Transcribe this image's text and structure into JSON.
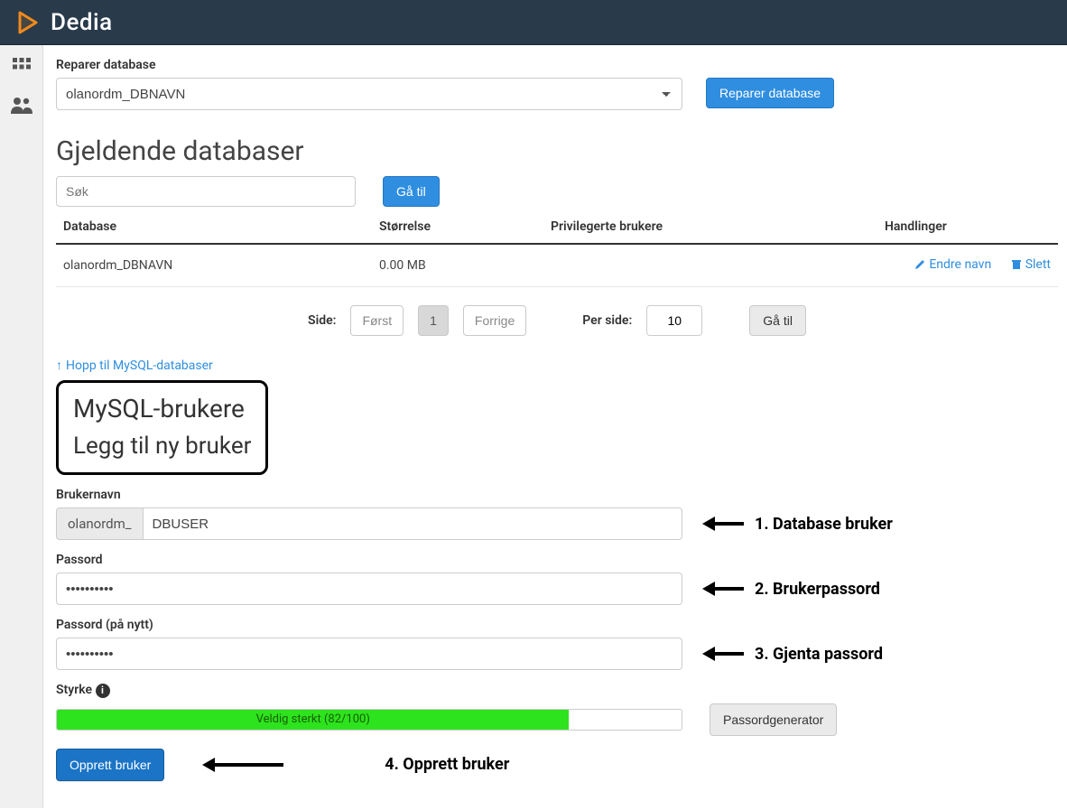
{
  "header": {
    "brand": "Dedia"
  },
  "repair": {
    "label": "Reparer database",
    "selected": "olanordm_DBNAVN",
    "button": "Reparer database"
  },
  "current_dbs": {
    "title": "Gjeldende databaser",
    "search_placeholder": "Søk",
    "goto": "Gå til",
    "columns": {
      "db": "Database",
      "size": "Størrelse",
      "users": "Privilegerte brukere",
      "actions": "Handlinger"
    },
    "rows": [
      {
        "name": "olanordm_DBNAVN",
        "size": "0.00 MB",
        "rename": "Endre navn",
        "delete": "Slett"
      }
    ],
    "page_label": "Side:",
    "first": "Først",
    "page_num": "1",
    "prev": "Forrige",
    "per_side_label": "Per side:",
    "per_side_value": "10",
    "goto2": "Gå til"
  },
  "jump": {
    "text": "Hopp til MySQL-databaser"
  },
  "users_section": {
    "title": "MySQL-brukere",
    "subtitle": "Legg til ny bruker",
    "username_label": "Brukernavn",
    "prefix": "olanordm_",
    "username_value": "DBUSER",
    "password_label": "Passord",
    "password_value": "••••••••••",
    "password2_label": "Passord (på nytt)",
    "password2_value": "••••••••••",
    "strength_label": "Styrke",
    "strength_text": "Veldig sterkt (82/100)",
    "generator": "Passordgenerator",
    "create": "Opprett bruker"
  },
  "annotations": {
    "a1": "1. Database bruker",
    "a2": "2. Brukerpassord",
    "a3": "3. Gjenta passord",
    "a4": "4. Opprett bruker"
  }
}
